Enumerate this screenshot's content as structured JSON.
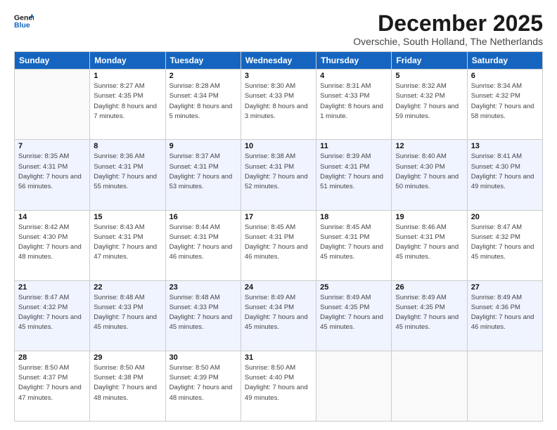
{
  "logo": {
    "line1": "General",
    "line2": "Blue"
  },
  "title": "December 2025",
  "subtitle": "Overschie, South Holland, The Netherlands",
  "headers": [
    "Sunday",
    "Monday",
    "Tuesday",
    "Wednesday",
    "Thursday",
    "Friday",
    "Saturday"
  ],
  "weeks": [
    [
      {
        "num": "",
        "sunrise": "",
        "sunset": "",
        "daylight": ""
      },
      {
        "num": "1",
        "sunrise": "Sunrise: 8:27 AM",
        "sunset": "Sunset: 4:35 PM",
        "daylight": "Daylight: 8 hours and 7 minutes."
      },
      {
        "num": "2",
        "sunrise": "Sunrise: 8:28 AM",
        "sunset": "Sunset: 4:34 PM",
        "daylight": "Daylight: 8 hours and 5 minutes."
      },
      {
        "num": "3",
        "sunrise": "Sunrise: 8:30 AM",
        "sunset": "Sunset: 4:33 PM",
        "daylight": "Daylight: 8 hours and 3 minutes."
      },
      {
        "num": "4",
        "sunrise": "Sunrise: 8:31 AM",
        "sunset": "Sunset: 4:33 PM",
        "daylight": "Daylight: 8 hours and 1 minute."
      },
      {
        "num": "5",
        "sunrise": "Sunrise: 8:32 AM",
        "sunset": "Sunset: 4:32 PM",
        "daylight": "Daylight: 7 hours and 59 minutes."
      },
      {
        "num": "6",
        "sunrise": "Sunrise: 8:34 AM",
        "sunset": "Sunset: 4:32 PM",
        "daylight": "Daylight: 7 hours and 58 minutes."
      }
    ],
    [
      {
        "num": "7",
        "sunrise": "Sunrise: 8:35 AM",
        "sunset": "Sunset: 4:31 PM",
        "daylight": "Daylight: 7 hours and 56 minutes."
      },
      {
        "num": "8",
        "sunrise": "Sunrise: 8:36 AM",
        "sunset": "Sunset: 4:31 PM",
        "daylight": "Daylight: 7 hours and 55 minutes."
      },
      {
        "num": "9",
        "sunrise": "Sunrise: 8:37 AM",
        "sunset": "Sunset: 4:31 PM",
        "daylight": "Daylight: 7 hours and 53 minutes."
      },
      {
        "num": "10",
        "sunrise": "Sunrise: 8:38 AM",
        "sunset": "Sunset: 4:31 PM",
        "daylight": "Daylight: 7 hours and 52 minutes."
      },
      {
        "num": "11",
        "sunrise": "Sunrise: 8:39 AM",
        "sunset": "Sunset: 4:31 PM",
        "daylight": "Daylight: 7 hours and 51 minutes."
      },
      {
        "num": "12",
        "sunrise": "Sunrise: 8:40 AM",
        "sunset": "Sunset: 4:30 PM",
        "daylight": "Daylight: 7 hours and 50 minutes."
      },
      {
        "num": "13",
        "sunrise": "Sunrise: 8:41 AM",
        "sunset": "Sunset: 4:30 PM",
        "daylight": "Daylight: 7 hours and 49 minutes."
      }
    ],
    [
      {
        "num": "14",
        "sunrise": "Sunrise: 8:42 AM",
        "sunset": "Sunset: 4:30 PM",
        "daylight": "Daylight: 7 hours and 48 minutes."
      },
      {
        "num": "15",
        "sunrise": "Sunrise: 8:43 AM",
        "sunset": "Sunset: 4:31 PM",
        "daylight": "Daylight: 7 hours and 47 minutes."
      },
      {
        "num": "16",
        "sunrise": "Sunrise: 8:44 AM",
        "sunset": "Sunset: 4:31 PM",
        "daylight": "Daylight: 7 hours and 46 minutes."
      },
      {
        "num": "17",
        "sunrise": "Sunrise: 8:45 AM",
        "sunset": "Sunset: 4:31 PM",
        "daylight": "Daylight: 7 hours and 46 minutes."
      },
      {
        "num": "18",
        "sunrise": "Sunrise: 8:45 AM",
        "sunset": "Sunset: 4:31 PM",
        "daylight": "Daylight: 7 hours and 45 minutes."
      },
      {
        "num": "19",
        "sunrise": "Sunrise: 8:46 AM",
        "sunset": "Sunset: 4:31 PM",
        "daylight": "Daylight: 7 hours and 45 minutes."
      },
      {
        "num": "20",
        "sunrise": "Sunrise: 8:47 AM",
        "sunset": "Sunset: 4:32 PM",
        "daylight": "Daylight: 7 hours and 45 minutes."
      }
    ],
    [
      {
        "num": "21",
        "sunrise": "Sunrise: 8:47 AM",
        "sunset": "Sunset: 4:32 PM",
        "daylight": "Daylight: 7 hours and 45 minutes."
      },
      {
        "num": "22",
        "sunrise": "Sunrise: 8:48 AM",
        "sunset": "Sunset: 4:33 PM",
        "daylight": "Daylight: 7 hours and 45 minutes."
      },
      {
        "num": "23",
        "sunrise": "Sunrise: 8:48 AM",
        "sunset": "Sunset: 4:33 PM",
        "daylight": "Daylight: 7 hours and 45 minutes."
      },
      {
        "num": "24",
        "sunrise": "Sunrise: 8:49 AM",
        "sunset": "Sunset: 4:34 PM",
        "daylight": "Daylight: 7 hours and 45 minutes."
      },
      {
        "num": "25",
        "sunrise": "Sunrise: 8:49 AM",
        "sunset": "Sunset: 4:35 PM",
        "daylight": "Daylight: 7 hours and 45 minutes."
      },
      {
        "num": "26",
        "sunrise": "Sunrise: 8:49 AM",
        "sunset": "Sunset: 4:35 PM",
        "daylight": "Daylight: 7 hours and 45 minutes."
      },
      {
        "num": "27",
        "sunrise": "Sunrise: 8:49 AM",
        "sunset": "Sunset: 4:36 PM",
        "daylight": "Daylight: 7 hours and 46 minutes."
      }
    ],
    [
      {
        "num": "28",
        "sunrise": "Sunrise: 8:50 AM",
        "sunset": "Sunset: 4:37 PM",
        "daylight": "Daylight: 7 hours and 47 minutes."
      },
      {
        "num": "29",
        "sunrise": "Sunrise: 8:50 AM",
        "sunset": "Sunset: 4:38 PM",
        "daylight": "Daylight: 7 hours and 48 minutes."
      },
      {
        "num": "30",
        "sunrise": "Sunrise: 8:50 AM",
        "sunset": "Sunset: 4:39 PM",
        "daylight": "Daylight: 7 hours and 48 minutes."
      },
      {
        "num": "31",
        "sunrise": "Sunrise: 8:50 AM",
        "sunset": "Sunset: 4:40 PM",
        "daylight": "Daylight: 7 hours and 49 minutes."
      },
      {
        "num": "",
        "sunrise": "",
        "sunset": "",
        "daylight": ""
      },
      {
        "num": "",
        "sunrise": "",
        "sunset": "",
        "daylight": ""
      },
      {
        "num": "",
        "sunrise": "",
        "sunset": "",
        "daylight": ""
      }
    ]
  ]
}
